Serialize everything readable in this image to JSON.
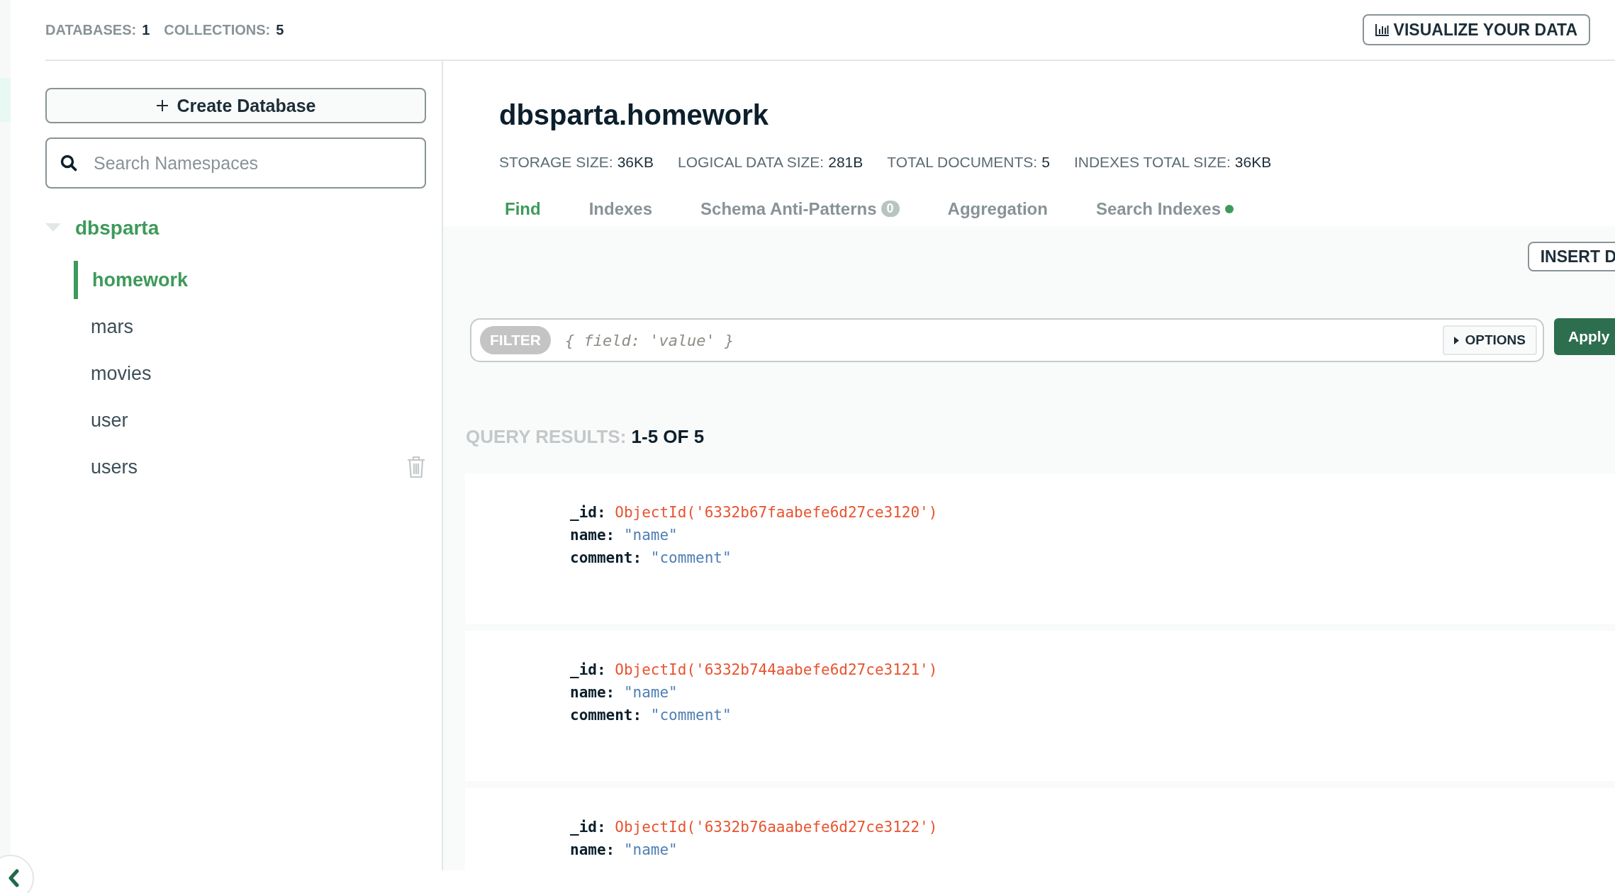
{
  "summary": [
    {
      "label": "DATABASES:",
      "value": "1"
    },
    {
      "label": "COLLECTIONS:",
      "value": "5"
    }
  ],
  "visualize_button": "VISUALIZE YOUR DATA",
  "sidebar": {
    "create_button": "Create Database",
    "search": {
      "placeholder": "Search Namespaces"
    },
    "tree": [
      {
        "name": "dbsparta",
        "expanded": true,
        "children": [
          {
            "name": "homework",
            "selected": true,
            "delete_icon": false
          },
          {
            "name": "mars",
            "selected": false,
            "delete_icon": false
          },
          {
            "name": "movies",
            "selected": false,
            "delete_icon": false
          },
          {
            "name": "user",
            "selected": false,
            "delete_icon": false
          },
          {
            "name": "users",
            "selected": false,
            "delete_icon": true
          }
        ]
      }
    ]
  },
  "collection": {
    "title": "dbsparta.homework",
    "stats": [
      {
        "label": "STORAGE SIZE:",
        "value": "36KB"
      },
      {
        "label": "LOGICAL DATA SIZE:",
        "value": "281B"
      },
      {
        "label": "TOTAL DOCUMENTS:",
        "value": "5"
      },
      {
        "label": "INDEXES TOTAL SIZE:",
        "value": "36KB"
      }
    ],
    "tabs": [
      {
        "label": "Find",
        "selected": true
      },
      {
        "label": "Indexes",
        "selected": false
      },
      {
        "label": "Schema Anti-Patterns",
        "selected": false,
        "badge": "0"
      },
      {
        "label": "Aggregation",
        "selected": false
      },
      {
        "label": "Search Indexes",
        "selected": false,
        "status_dot": true
      }
    ]
  },
  "insert_button": "INSERT D",
  "filter": {
    "label": "FILTER",
    "placeholder": "{ field: 'value' }",
    "options_button": "OPTIONS",
    "apply_button": "Apply"
  },
  "results": {
    "label": "QUERY RESULTS:",
    "range": "1-5 OF 5"
  },
  "documents": [
    {
      "fields": [
        {
          "key": "_id:",
          "value": "ObjectId('6332b67faabefe6d27ce3120')",
          "kind": "objectid"
        },
        {
          "key": "name:",
          "value": "\"name\"",
          "kind": "string"
        },
        {
          "key": "comment:",
          "value": "\"comment\"",
          "kind": "string"
        }
      ]
    },
    {
      "fields": [
        {
          "key": "_id:",
          "value": "ObjectId('6332b744aabefe6d27ce3121')",
          "kind": "objectid"
        },
        {
          "key": "name:",
          "value": "\"name\"",
          "kind": "string"
        },
        {
          "key": "comment:",
          "value": "\"comment\"",
          "kind": "string"
        }
      ]
    },
    {
      "fields": [
        {
          "key": "_id:",
          "value": "ObjectId('6332b76aaabefe6d27ce3122')",
          "kind": "objectid"
        },
        {
          "key": "name:",
          "value": "\"name\"",
          "kind": "string"
        }
      ]
    }
  ]
}
